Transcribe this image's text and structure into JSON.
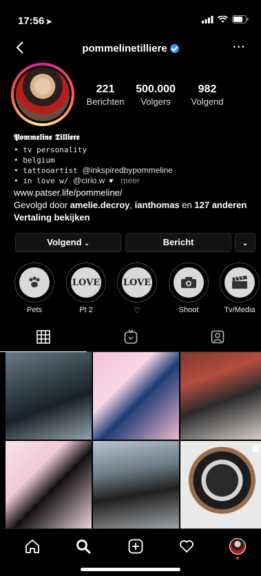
{
  "status_bar": {
    "time": "17:56"
  },
  "header": {
    "username": "pommelinetilliere"
  },
  "stats": [
    {
      "value": "221",
      "label": "Berichten"
    },
    {
      "value": "500.000",
      "label": "Volgers"
    },
    {
      "value": "982",
      "label": "Volgend"
    }
  ],
  "bio": {
    "name": "𝕻𝖔𝖒𝖒𝖊𝖑𝖎𝖓𝖊 𝕿𝖎𝖑𝖑𝖎𝖊𝖗𝖊",
    "line1": "• tv personality",
    "line2": "• belgium",
    "line3_prefix": "• tattooartist",
    "line3_tag": "@inkspiredbypommeline",
    "line4_prefix": "• in love w/",
    "line4_tag": "@cirio.w",
    "more": "meer",
    "link": "www.patser.life/pommeline/",
    "followed_prefix": "Gevolgd door",
    "followed_user1": "amelie.decroy",
    "followed_sep": ",",
    "followed_user2": "ianthomas",
    "followed_mid": "en",
    "followed_count": "127 anderen",
    "translate": "Vertaling bekijken"
  },
  "buttons": {
    "following": "Volgend",
    "message": "Bericht"
  },
  "highlights": [
    {
      "label": "Pets",
      "icon": "paw-icon"
    },
    {
      "label": "Pt 2",
      "icon": "love-icon"
    },
    {
      "label": "♡",
      "icon": "love-icon"
    },
    {
      "label": "Shoot",
      "icon": "camera-icon"
    },
    {
      "label": "Tv/Media",
      "icon": "clapperboard-icon"
    }
  ],
  "highlight_cover_text": "LOVE"
}
